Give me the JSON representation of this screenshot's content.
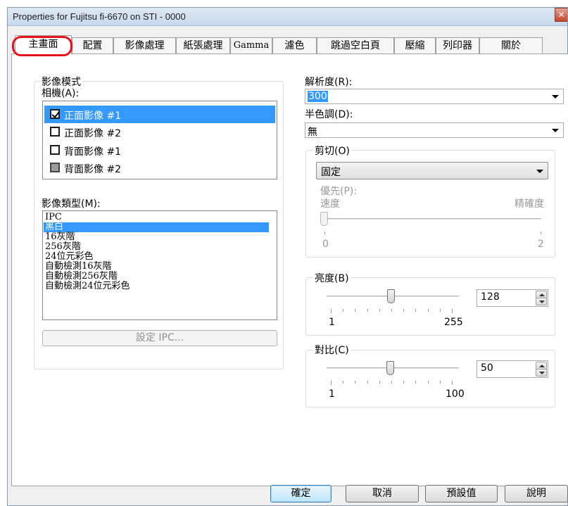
{
  "window": {
    "title": "Properties for Fujitsu fi-6670 on STI - 0000",
    "close_label": "✕"
  },
  "tabs": [
    {
      "label": "主畫面",
      "active": true
    },
    {
      "label": "配置"
    },
    {
      "label": "影像處理"
    },
    {
      "label": "紙張處理"
    },
    {
      "label": "Gamma"
    },
    {
      "label": "濾色"
    },
    {
      "label": "跳過空白頁"
    },
    {
      "label": "壓縮"
    },
    {
      "label": "列印器"
    },
    {
      "label": "關於"
    }
  ],
  "image_mode": {
    "group_label": "影像模式",
    "camera_label": "相機(A):",
    "cameras": [
      {
        "label": "正面影像 #1",
        "checked": true,
        "selected": true
      },
      {
        "label": "正面影像 #2",
        "checked": false
      },
      {
        "label": "背面影像 #1",
        "checked": false
      },
      {
        "label": "背面影像 #2",
        "checked": false,
        "grayed": true
      }
    ],
    "type_label": "影像類型(M):",
    "types": [
      {
        "label": "IPC"
      },
      {
        "label": "黑白",
        "selected": true
      },
      {
        "label": "16灰階"
      },
      {
        "label": "256灰階"
      },
      {
        "label": "24位元彩色"
      },
      {
        "label": "自動檢測16灰階"
      },
      {
        "label": "自動檢測256灰階"
      },
      {
        "label": "自動檢測24位元彩色"
      }
    ],
    "setup_button": "設定 IPC..."
  },
  "resolution": {
    "label": "解析度(R):",
    "value": "300"
  },
  "halftone": {
    "label": "半色調(D):",
    "value": "無"
  },
  "cropping": {
    "group_label": "剪切(O)",
    "value": "固定",
    "priority_label": "優先(P):",
    "left_label": "速度",
    "right_label": "精確度",
    "min_label": "0",
    "max_label": "2",
    "level": 0
  },
  "brightness": {
    "group_label": "亮度(B)",
    "value": "128",
    "min_label": "1",
    "max_label": "255",
    "min": 1,
    "max": 255
  },
  "contrast": {
    "group_label": "對比(C)",
    "value": "50",
    "min_label": "1",
    "max_label": "100",
    "min": 1,
    "max": 100
  },
  "footer": {
    "ok": "確定",
    "cancel": "取消",
    "defaults": "預設值",
    "help": "說明"
  },
  "colors": {
    "selection": "#3399ff",
    "tab_highlight": "#e8121d",
    "close_button": "#c7452e"
  }
}
